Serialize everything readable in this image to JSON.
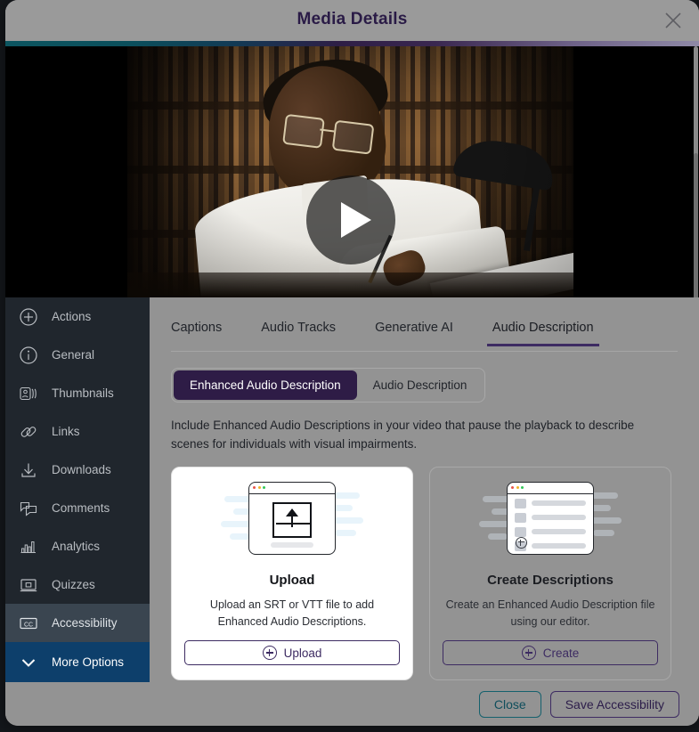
{
  "window": {
    "title": "Media Details",
    "close_icon": "close-icon"
  },
  "accent_colors": {
    "teal": "#0c5560",
    "purple": "#2e1c46",
    "light_purple": "#8f89a6",
    "sidebar_bg": "#20262d",
    "sidebar_active": "#3a4550",
    "more_options_bg": "#0d3f6b",
    "panel_bg": "#939393"
  },
  "video": {
    "play_button_label": "Play",
    "play_icon": "play-icon"
  },
  "sidebar": {
    "items": [
      {
        "label": "Actions",
        "icon": "plus-circle-icon",
        "active": false
      },
      {
        "label": "General",
        "icon": "info-circle-icon",
        "active": false
      },
      {
        "label": "Thumbnails",
        "icon": "thumbnails-icon",
        "active": false
      },
      {
        "label": "Links",
        "icon": "link-icon",
        "active": false
      },
      {
        "label": "Downloads",
        "icon": "download-icon",
        "active": false
      },
      {
        "label": "Comments",
        "icon": "comments-icon",
        "active": false
      },
      {
        "label": "Analytics",
        "icon": "bar-chart-icon",
        "active": false
      },
      {
        "label": "Quizzes",
        "icon": "quiz-screen-icon",
        "active": false
      },
      {
        "label": "Accessibility",
        "icon": "closed-caption-icon",
        "active": true
      }
    ],
    "more_options": {
      "label": "More Options",
      "icon": "chevron-down-icon"
    }
  },
  "main": {
    "tabs": [
      {
        "label": "Captions",
        "active": false
      },
      {
        "label": "Audio Tracks",
        "active": false
      },
      {
        "label": "Generative AI",
        "active": false
      },
      {
        "label": "Audio Description",
        "active": true
      }
    ],
    "segmented": [
      {
        "label": "Enhanced Audio Description",
        "active": true
      },
      {
        "label": "Audio Description",
        "active": false
      }
    ],
    "description": "Include Enhanced Audio Descriptions in your video that pause the playback to describe scenes for individuals with visual impairments.",
    "cards": [
      {
        "title": "Upload",
        "text": "Upload an SRT or VTT file to add Enhanced Audio Descriptions.",
        "button_label": "Upload",
        "button_icon": "plus-circle-icon",
        "art": "upload-illustration"
      },
      {
        "title": "Create Descriptions",
        "text": "Create an Enhanced Audio Description file using our editor.",
        "button_label": "Create",
        "button_icon": "plus-circle-icon",
        "art": "editor-list-illustration"
      }
    ]
  },
  "footer": {
    "close_label": "Close",
    "save_label": "Save Accessibility"
  }
}
